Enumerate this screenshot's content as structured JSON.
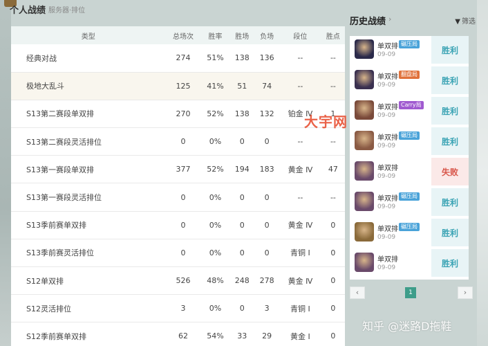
{
  "header": {
    "title": "个人战绩",
    "subtitle": "服务器·排位"
  },
  "stats": {
    "columns": [
      "类型",
      "总场次",
      "胜率",
      "胜场",
      "负场",
      "段位",
      "胜点"
    ],
    "rows": [
      [
        "经典对战",
        "274",
        "51%",
        "138",
        "136",
        "--",
        "--"
      ],
      [
        "极地大乱斗",
        "125",
        "41%",
        "51",
        "74",
        "--",
        "--"
      ],
      [
        "S13第二赛段单双排",
        "270",
        "52%",
        "138",
        "132",
        "铂金 Ⅳ",
        "1"
      ],
      [
        "S13第二赛段灵活排位",
        "0",
        "0%",
        "0",
        "0",
        "--",
        "--"
      ],
      [
        "S13第一赛段单双排",
        "377",
        "52%",
        "194",
        "183",
        "黄金 Ⅳ",
        "47"
      ],
      [
        "S13第一赛段灵活排位",
        "0",
        "0%",
        "0",
        "0",
        "--",
        "--"
      ],
      [
        "S13季前赛单双排",
        "0",
        "0%",
        "0",
        "0",
        "黄金 Ⅳ",
        "0"
      ],
      [
        "S13季前赛灵活排位",
        "0",
        "0%",
        "0",
        "0",
        "青铜 Ⅰ",
        "0"
      ],
      [
        "S12单双排",
        "526",
        "48%",
        "248",
        "278",
        "黄金 Ⅳ",
        "0"
      ],
      [
        "S12灵活排位",
        "3",
        "0%",
        "0",
        "3",
        "青铜 Ⅰ",
        "0"
      ],
      [
        "S12季前赛单双排",
        "62",
        "54%",
        "33",
        "29",
        "黄金 Ⅰ",
        "0"
      ]
    ]
  },
  "history": {
    "title": "历史战绩",
    "filter_label": "筛选",
    "filter_icon": "filter-icon",
    "matches": [
      {
        "mode": "单双排",
        "tag": "碾压局",
        "tag_color": "#4aa3d9",
        "date": "09-09",
        "result": "胜利",
        "outcome": "win",
        "champ_color": "#2b2a4a"
      },
      {
        "mode": "单双排",
        "tag": "翻盘局",
        "tag_color": "#e0713a",
        "date": "09-09",
        "result": "胜利",
        "outcome": "win",
        "champ_color": "#3a3050"
      },
      {
        "mode": "单双排",
        "tag": "Carry局",
        "tag_color": "#a05ad0",
        "date": "09-09",
        "result": "胜利",
        "outcome": "win",
        "champ_color": "#7a4a3a"
      },
      {
        "mode": "单双排",
        "tag": "碾压局",
        "tag_color": "#4aa3d9",
        "date": "09-09",
        "result": "胜利",
        "outcome": "win",
        "champ_color": "#8a5a44"
      },
      {
        "mode": "单双排",
        "tag": "",
        "tag_color": "",
        "date": "09-09",
        "result": "失败",
        "outcome": "lose",
        "champ_color": "#6a4a6a"
      },
      {
        "mode": "单双排",
        "tag": "碾压局",
        "tag_color": "#4aa3d9",
        "date": "09-09",
        "result": "胜利",
        "outcome": "win",
        "champ_color": "#6a4a6a"
      },
      {
        "mode": "单双排",
        "tag": "碾压局",
        "tag_color": "#4aa3d9",
        "date": "09-09",
        "result": "胜利",
        "outcome": "win",
        "champ_color": "#8a6a3a"
      },
      {
        "mode": "单双排",
        "tag": "",
        "tag_color": "",
        "date": "09-09",
        "result": "胜利",
        "outcome": "win",
        "champ_color": "#6a4a6a"
      }
    ]
  },
  "pager": {
    "prev": "‹",
    "current_page": "1",
    "next": "›"
  },
  "watermarks": {
    "red": "大宇网",
    "zhihu": "知乎 @迷路D拖鞋"
  }
}
